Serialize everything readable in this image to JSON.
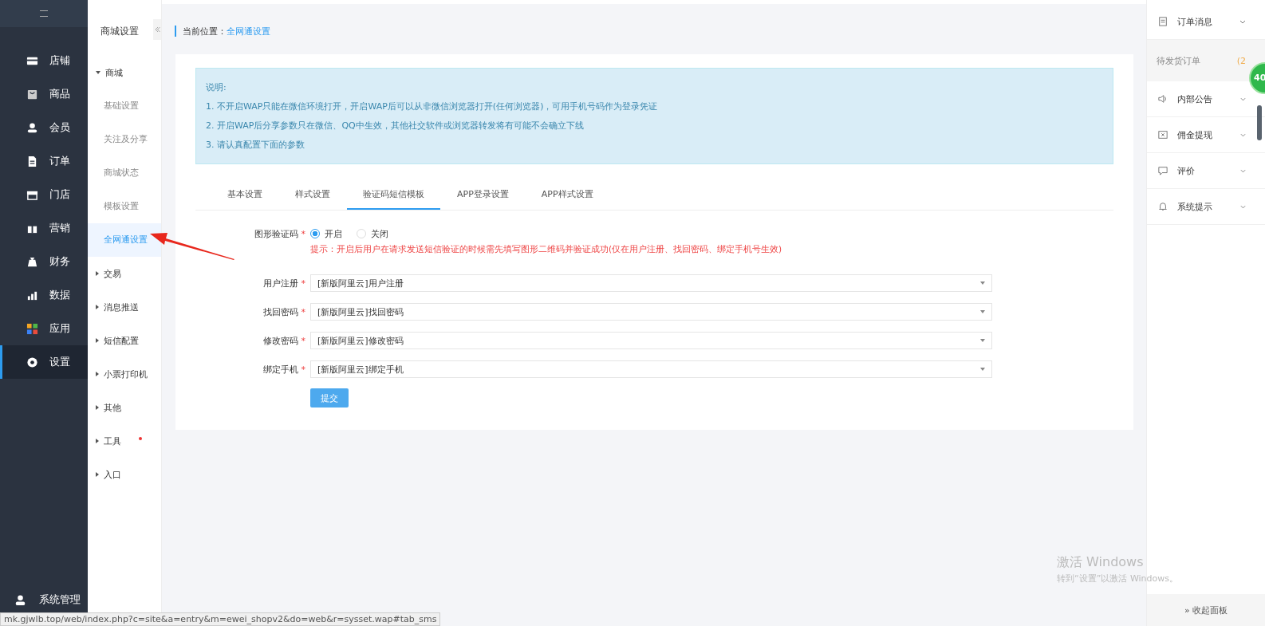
{
  "main_nav": {
    "items": [
      {
        "label": "店铺",
        "selected": false
      },
      {
        "label": "商品",
        "selected": false
      },
      {
        "label": "会员",
        "selected": false
      },
      {
        "label": "订单",
        "selected": false
      },
      {
        "label": "门店",
        "selected": false
      },
      {
        "label": "营销",
        "selected": false
      },
      {
        "label": "财务",
        "selected": false
      },
      {
        "label": "数据",
        "selected": false
      },
      {
        "label": "应用",
        "selected": false
      },
      {
        "label": "设置",
        "selected": true
      }
    ],
    "footer": "系统管理"
  },
  "sub_nav": {
    "title": "商城设置",
    "groups": [
      {
        "label": "商城",
        "expanded": true,
        "dot": false,
        "children": [
          {
            "label": "基础设置",
            "selected": false
          },
          {
            "label": "关注及分享",
            "selected": false
          },
          {
            "label": "商城状态",
            "selected": false
          },
          {
            "label": "模板设置",
            "selected": false
          },
          {
            "label": "全网通设置",
            "selected": true
          }
        ]
      },
      {
        "label": "交易",
        "expanded": false,
        "dot": false
      },
      {
        "label": "消息推送",
        "expanded": false,
        "dot": false
      },
      {
        "label": "短信配置",
        "expanded": false,
        "dot": false
      },
      {
        "label": "小票打印机",
        "expanded": false,
        "dot": false
      },
      {
        "label": "其他",
        "expanded": false,
        "dot": false
      },
      {
        "label": "工具",
        "expanded": false,
        "dot": true
      },
      {
        "label": "入口",
        "expanded": false,
        "dot": false
      }
    ]
  },
  "breadcrumb": {
    "label": "当前位置：",
    "current": "全网通设置"
  },
  "notice": {
    "title": "说明:",
    "lines": [
      "1. 不开启WAP只能在微信环境打开，开启WAP后可以从非微信浏览器打开(任何浏览器)，可用手机号码作为登录凭证",
      "2. 开启WAP后分享参数只在微信、QQ中生效，其他社交软件或浏览器转发将有可能不会确立下线",
      "3. 请认真配置下面的参数"
    ]
  },
  "tabs": [
    {
      "label": "基本设置",
      "selected": false
    },
    {
      "label": "样式设置",
      "selected": false
    },
    {
      "label": "验证码短信模板",
      "selected": true
    },
    {
      "label": "APP登录设置",
      "selected": false
    },
    {
      "label": "APP样式设置",
      "selected": false
    }
  ],
  "form": {
    "captcha": {
      "label": "图形验证码",
      "required_mark": "*",
      "options": [
        {
          "label": "开启",
          "selected": true
        },
        {
          "label": "关闭",
          "selected": false
        }
      ],
      "hint": "提示：开启后用户在请求发送短信验证的时候需先填写图形二维码并验证成功(仅在用户注册、找回密码、绑定手机号生效)"
    },
    "selects": [
      {
        "label": "用户注册",
        "required_mark": "*",
        "value": "[新版阿里云]用户注册"
      },
      {
        "label": "找回密码",
        "required_mark": "*",
        "value": "[新版阿里云]找回密码"
      },
      {
        "label": "修改密码",
        "required_mark": "*",
        "value": "[新版阿里云]修改密码"
      },
      {
        "label": "绑定手机",
        "required_mark": "*",
        "value": "[新版阿里云]绑定手机"
      }
    ],
    "submit": "提交"
  },
  "right_panel": {
    "sections": [
      {
        "label": "订单消息",
        "expanded": true,
        "items": [
          {
            "label": "待发货订单",
            "count": "(2"
          }
        ]
      },
      {
        "label": "内部公告",
        "expanded": false
      },
      {
        "label": "佣金提现",
        "expanded": false
      },
      {
        "label": "评价",
        "expanded": false
      },
      {
        "label": "系统提示",
        "expanded": false
      }
    ],
    "collapse": "» 收起面板"
  },
  "float_badge": "40",
  "activation": {
    "title": "激活 Windows",
    "subtitle": "转到“设置”以激活 Windows。"
  },
  "status_url": "mk.gjwlb.top/web/index.php?c=site&a=entry&m=ewei_shopv2&do=web&r=sysset.wap#tab_sms"
}
